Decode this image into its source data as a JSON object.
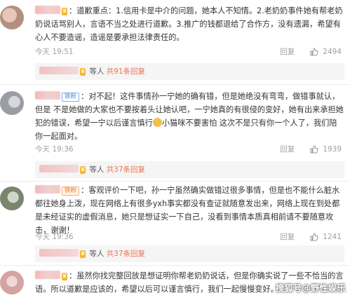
{
  "comments": [
    {
      "text": "道歉重点：1.信用卡是中介的问题，她本人不知情。2.老奶奶事件她有帮老奶奶说话骂别人，言语不当之处进行道歉。3.推广的钱都退给了合作方，没有遗漏，希望有心人不要造谣，造谣是要承担法律责任的。",
      "time": "今天 19:51",
      "reply_label": "回复",
      "likes": "2494",
      "reply_bar": {
        "suffix": "等人",
        "more": "共91条回复"
      }
    },
    {
      "badge": "铁粉",
      "text": "对不起！这件事情孙一宁她的确有错，但是她绝没有弯弯，做错事就认，但是 不是她做的大家也不要按着头让她认吧，一宁她真的有很侵的变好，她有出来承担她犯的错误，希望一宁以后谨言慎行",
      "text_tail": "小猫咪不要害怕 这次不是只有你一个人了，我们陪你一起面对。",
      "time": "今天 19:36",
      "reply_label": "回复",
      "likes": "1939",
      "reply_bar": {
        "suffix": "等人",
        "more": "共37条回复"
      }
    },
    {
      "badge": "铁粉",
      "text": "客观评价一下吧，孙一宁虽然确实做错过很多事情，但是也不能什么脏水都往她身上泼，现在网络上有很多yxh事实都没有查证就随意发出来，网络上现在到处都是未经证实的虚假消息，她只是想证实一下自己，没看到事情本质真相前请不要随意攻击，谢谢！",
      "time": "今天 19:36",
      "reply_label": "回复",
      "likes": "1241",
      "reply_bar": {
        "suffix": "等人",
        "more": "共37条回复"
      }
    },
    {
      "text": "虽然你找完整回放是想证明你帮老奶奶说话，但是你确实说了一些不恰当的言语。所以道歉是应该的，希望以后可以谨言慎行，我们一起慢慢变好。"
    }
  ],
  "watermark": "搜狐号@野性娱乐"
}
